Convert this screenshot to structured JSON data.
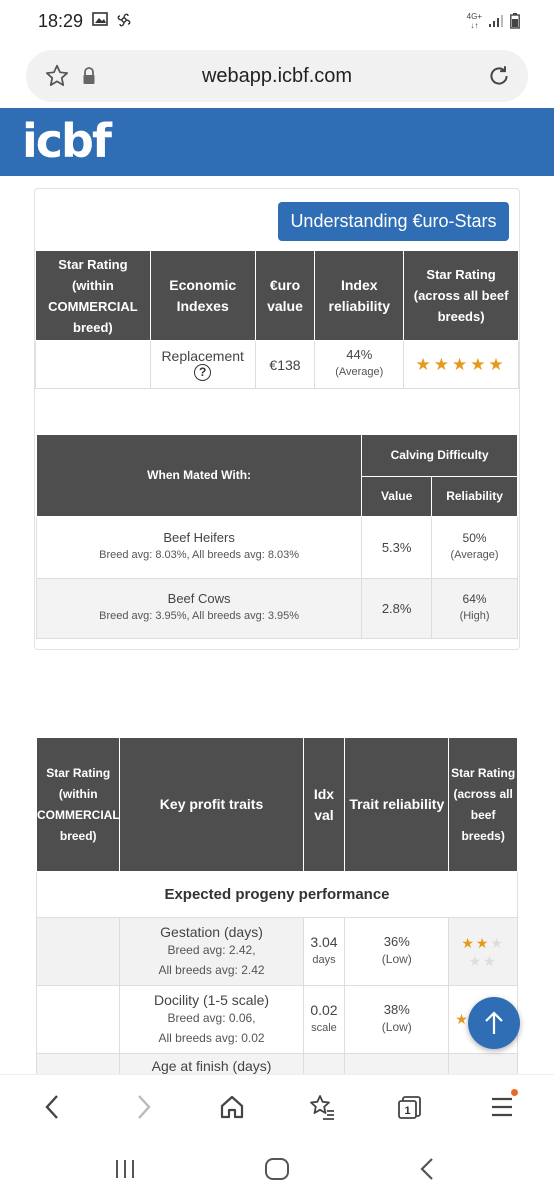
{
  "status_bar": {
    "time": "18:29",
    "network": "4G+"
  },
  "browser": {
    "url": "webapp.icbf.com"
  },
  "header": {
    "logo": "icbf"
  },
  "understanding_button": "Understanding €uro-Stars",
  "index_table": {
    "headers": [
      "Star Rating (within COMMERCIAL breed)",
      "Economic Indexes",
      "€uro value",
      "Index reliability",
      "Star Rating (across all beef breeds)"
    ],
    "row": {
      "star_within": "",
      "index": "Replacement",
      "help": "?",
      "value": "€138",
      "reliability": "44%",
      "reliability_label": "(Average)",
      "stars": "★★★★★",
      "stars_value": 5
    }
  },
  "calving_table": {
    "col_mated": "When Mated With:",
    "col_group": "Calving Difficulty",
    "col_value": "Value",
    "col_reliability": "Reliability",
    "rows": [
      {
        "name": "Beef Heifers",
        "sub": "Breed avg: 8.03%, All breeds avg: 8.03%",
        "value": "5.3%",
        "reliability": "50%",
        "reliability_label": "(Average)"
      },
      {
        "name": "Beef Cows",
        "sub": "Breed avg: 3.95%, All breeds avg: 3.95%",
        "value": "2.8%",
        "reliability": "64%",
        "reliability_label": "(High)"
      }
    ]
  },
  "traits_table": {
    "headers": [
      "Star Rating (within COMMERCIAL breed)",
      "Key profit traits",
      "Idx val",
      "Trait reliability",
      "Star Rating (across all beef breeds)"
    ],
    "section": "Expected progeny performance",
    "rows": [
      {
        "name": "Gestation (days)",
        "breed_avg": "Breed avg: 2.42,",
        "all_avg": "All breeds avg: 2.42",
        "value": "3.04",
        "unit": "days",
        "reliability": "36%",
        "reliability_label": "(Low)",
        "stars_value": 2
      },
      {
        "name": "Docility (1-5 scale)",
        "breed_avg": "Breed avg: 0.06,",
        "all_avg": "All breeds avg: 0.02",
        "value": "0.02",
        "unit": "scale",
        "reliability": "38%",
        "reliability_label": "(Low)",
        "stars_value": 1
      },
      {
        "name": "Age at finish (days)",
        "breed_avg": "",
        "all_avg": "",
        "value": "",
        "unit": "",
        "reliability": "",
        "reliability_label": "",
        "stars_value": null
      }
    ]
  },
  "colors": {
    "brand_blue": "#2f6db5",
    "header_grey": "#4e4e4e",
    "star_gold": "#e59a1e",
    "notification": "#e8692a"
  },
  "nav": {
    "tab_count": "1"
  }
}
